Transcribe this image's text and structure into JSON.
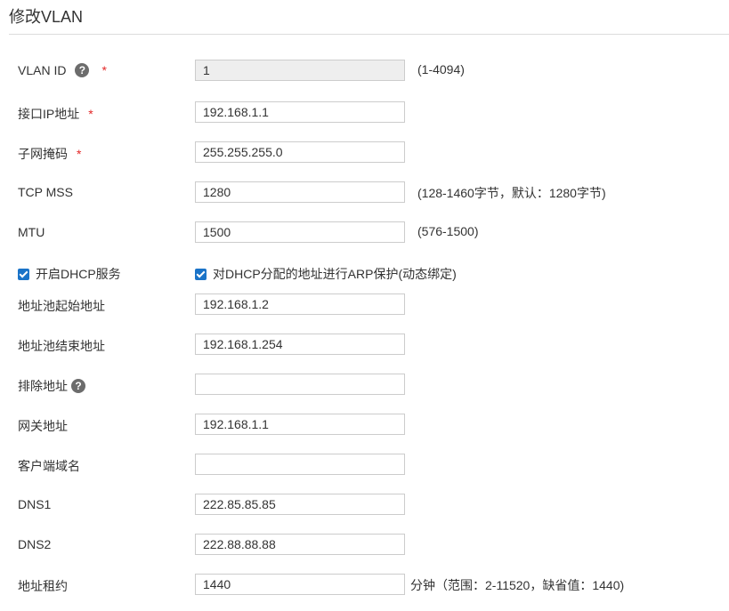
{
  "page": {
    "title": "修改VLAN"
  },
  "form": {
    "vlan_id": {
      "label": "VLAN ID",
      "required_mark": "*",
      "help": "?",
      "value": "1",
      "hint": "(1-4094)"
    },
    "interface_ip": {
      "label": "接口IP地址",
      "required_mark": "*",
      "value": "192.168.1.1"
    },
    "subnet_mask": {
      "label": "子网掩码",
      "required_mark": "*",
      "value": "255.255.255.0"
    },
    "tcp_mss": {
      "label": "TCP MSS",
      "value": "1280",
      "hint": "(128-1460字节，默认：1280字节)"
    },
    "mtu": {
      "label": "MTU",
      "value": "1500",
      "hint": "(576-1500)"
    },
    "enable_dhcp": {
      "label": "开启DHCP服务",
      "checked": true
    },
    "arp_protect": {
      "label": "对DHCP分配的地址进行ARP保护(动态绑定)",
      "checked": true
    },
    "pool_start": {
      "label": "地址池起始地址",
      "value": "192.168.1.2"
    },
    "pool_end": {
      "label": "地址池结束地址",
      "value": "192.168.1.254"
    },
    "exclude": {
      "label": "排除地址",
      "help": "?",
      "value": ""
    },
    "gateway": {
      "label": "网关地址",
      "value": "192.168.1.1"
    },
    "domain": {
      "label": "客户端域名",
      "value": ""
    },
    "dns1": {
      "label": "DNS1",
      "value": "222.85.85.85"
    },
    "dns2": {
      "label": "DNS2",
      "value": "222.88.88.88"
    },
    "lease": {
      "label": "地址租约",
      "value": "1440",
      "hint": "分钟（范围：2-11520，缺省值：1440)"
    }
  },
  "colors": {
    "accent": "#1a73c8",
    "required": "#e32828",
    "readonly_bg": "#eeeeee",
    "border": "#cccccc"
  }
}
